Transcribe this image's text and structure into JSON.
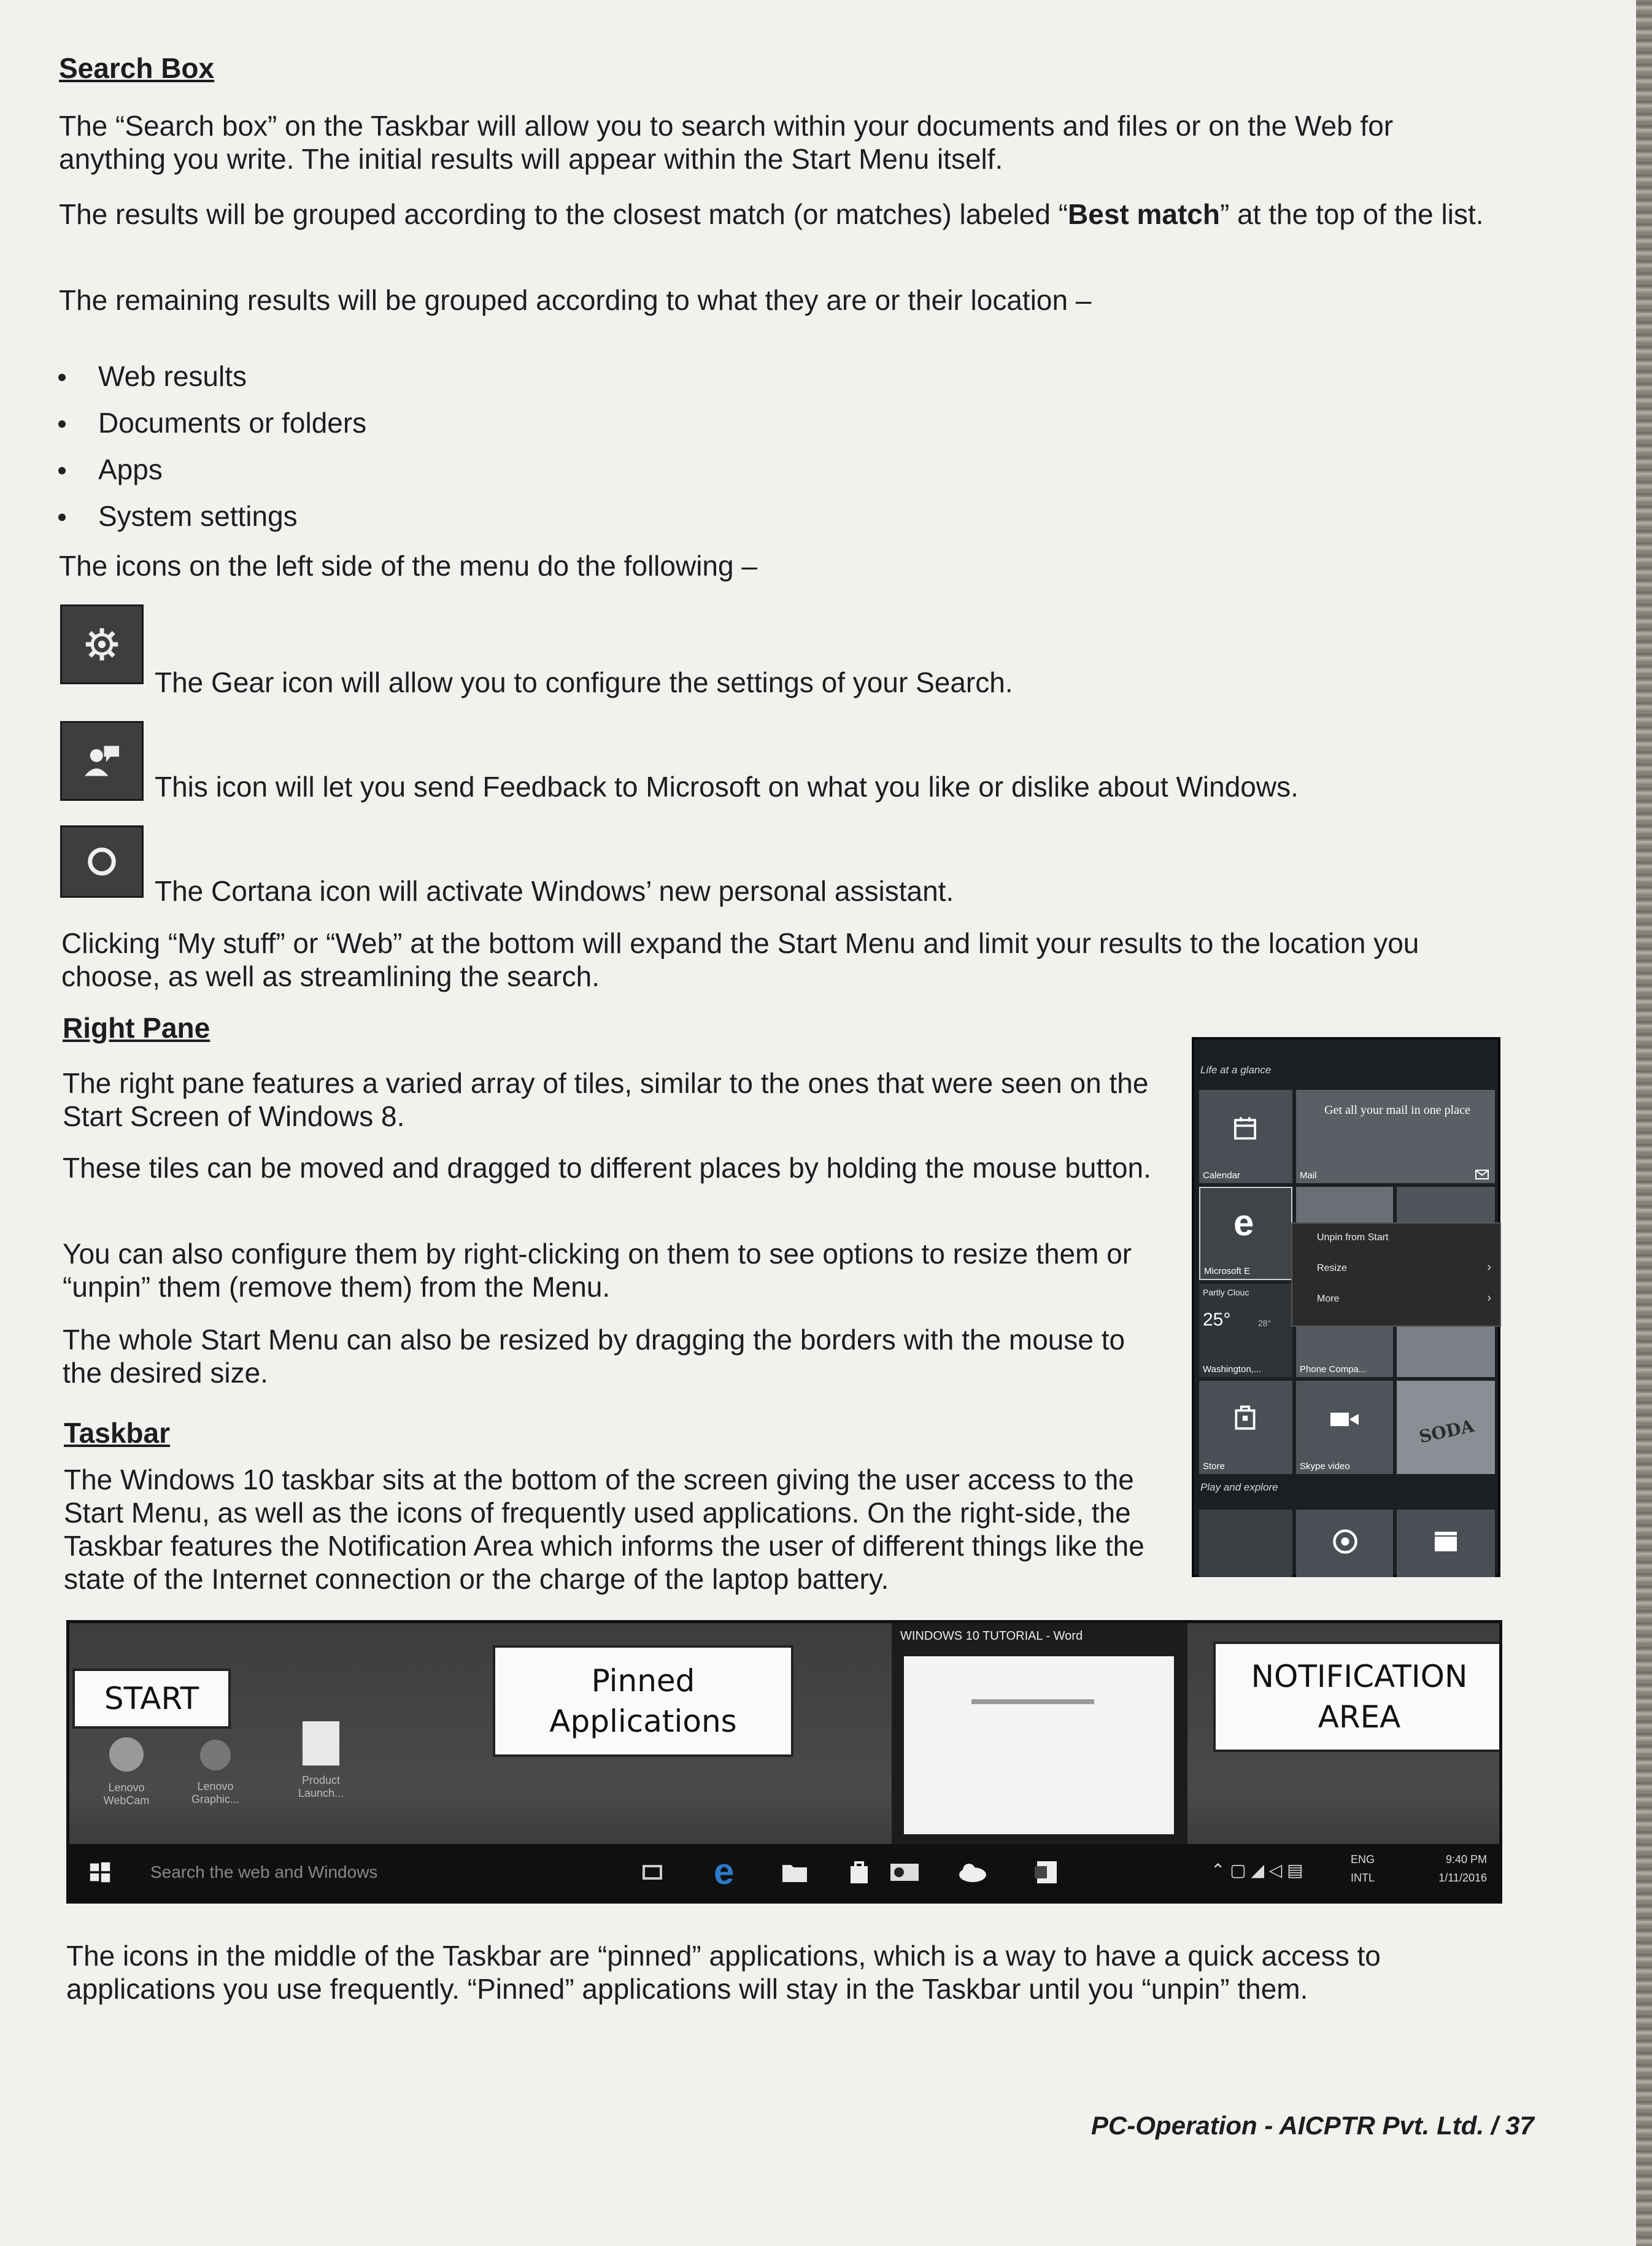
{
  "search_box": {
    "heading": "Search Box",
    "para1": "The “Search box” on the Taskbar will allow you to search within your documents and files or on the Web for anything you write. The initial results will appear within the Start Menu itself.",
    "para2_before": "The results will be grouped according to the closest match (or matches) labeled “",
    "para2_bold": "Best match",
    "para2_after": "” at the top of the list.",
    "para3": "The remaining results will be grouped according to what they are or their location –",
    "bullets": [
      "Web results",
      "Documents or folders",
      "Apps",
      "System settings"
    ],
    "icons_intro": "The icons on the left side of the menu do the following –",
    "icon_items": [
      {
        "icon": "gear-icon",
        "text": "The Gear icon will allow you to configure the settings of your Search."
      },
      {
        "icon": "feedback-icon",
        "text": "This icon will let you send Feedback to Microsoft on what you like or dislike about Windows."
      },
      {
        "icon": "cortana-icon",
        "text": "The Cortana icon will activate Windows’ new personal assistant."
      }
    ],
    "para4": "Clicking “My stuff” or “Web” at the bottom will expand the Start Menu and limit your results to the location you choose, as well as streamlining the search."
  },
  "right_pane": {
    "heading": "Right Pane",
    "para1": "The right pane features a varied array of tiles, similar to the ones that were seen on the Start Screen of Windows 8.",
    "para2": "These tiles can be moved and dragged to different places by holding the mouse button.",
    "para3": "You can also configure them by right-clicking on them to see options to resize them or “unpin” them (remove them) from the Menu.",
    "para4": "The whole Start Menu can also be resized by dragging the borders with the mouse to the desired size."
  },
  "start_menu_shot": {
    "group1": "Life at a glance",
    "mail_promo": "Get all your mail in one place",
    "calendar": "Calendar",
    "mail": "Mail",
    "edge": "Microsoft E",
    "weather_cond": "Partly Clouc",
    "temp": "25°",
    "temp_low": "28°",
    "city": "Washington,...",
    "phone": "Phone Compa...",
    "store": "Store",
    "skype": "Skype video",
    "soda": "SODA",
    "group2": "Play and explore",
    "menu_unpin": "Unpin from Start",
    "menu_resize": "Resize",
    "menu_more": "More"
  },
  "taskbar": {
    "heading": "Taskbar",
    "para1": "The Windows 10 taskbar sits at the bottom of the screen giving the user access to the Start Menu, as well as the icons of frequently used applications. On the right-side, the Taskbar features the Notification Area which informs the user of different things like the state of the Internet connection or the charge of the laptop battery.",
    "para2": "The icons in the middle of the Taskbar are “pinned” applications, which is a way to have a quick access to applications you use frequently. “Pinned” applications will stay in the Taskbar until you “unpin” them."
  },
  "taskbar_shot": {
    "callout_start": "START",
    "callout_pinned_1": "Pinned",
    "callout_pinned_2": "Applications",
    "callout_notif_1": "NOTIFICATION",
    "callout_notif_2": "AREA",
    "search_placeholder": "Search the web and Windows",
    "word_window": "WINDOWS 10 TUTORIAL - Word",
    "desktop_icon1": "Lenovo WebCam",
    "desktop_icon2": "Lenovo Graphic...",
    "desktop_icon3": "Product Launch...",
    "lang1": "ENG",
    "lang2": "INTL",
    "time": "9:40 PM",
    "date": "1/11/2016"
  },
  "footer": {
    "text": "PC-Operation - AICPTR Pvt. Ltd. / 37"
  }
}
